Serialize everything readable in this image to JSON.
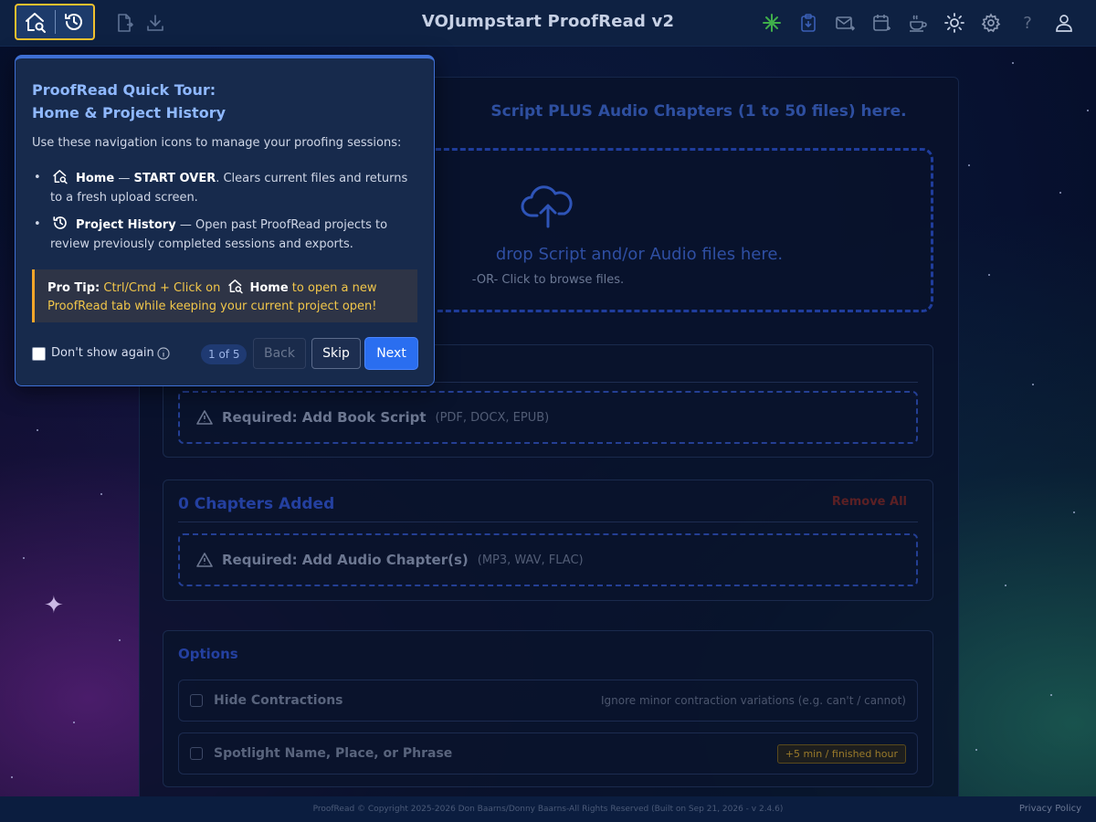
{
  "header": {
    "title": "VOJumpstart ProofRead v2"
  },
  "upload": {
    "heading": "Script PLUS Audio Chapters (1 to 50 files) here.",
    "drop_main": "drop Script and/or Audio files here.",
    "drop_sub": "-OR- Click to browse files."
  },
  "script_section": {
    "required_label": "Required: Add Book Script",
    "formats": "(PDF, DOCX, EPUB)"
  },
  "chapters_section": {
    "title": "0 Chapters Added",
    "remove_all": "Remove All",
    "required_label": "Required: Add Audio Chapter(s)",
    "formats": "(MP3, WAV, FLAC)"
  },
  "options": {
    "title": "Options",
    "items": [
      {
        "label": "Hide Contractions",
        "hint": "Ignore minor contraction variations (e.g. can't / cannot)"
      },
      {
        "label": "Spotlight Name, Place, or Phrase",
        "badge": "+5 min / finished hour"
      }
    ]
  },
  "footer": {
    "copyright": "ProofRead © Copyright 2025-2026 Don Baarns/Donny Baarns-All Rights Reserved (Built on Sep 21, 2026 - v 2.4.6)",
    "privacy": "Privacy Policy"
  },
  "tour": {
    "title_line1": "ProofRead Quick Tour:",
    "title_line2": "Home & Project History",
    "intro": "Use these navigation icons to manage your proofing sessions:",
    "items": [
      {
        "name": "Home",
        "sep": " — ",
        "emphasis": "START OVER",
        "text": ". Clears current files and returns to a fresh upload screen."
      },
      {
        "name": "Project History",
        "sep": " — ",
        "text": "Open past ProofRead projects to review previously completed sessions and exports."
      }
    ],
    "tip": {
      "label": "Pro Tip:",
      "text1": " Ctrl/Cmd + Click on ",
      "home": "Home",
      "text2": " to open a new ProofRead tab while keeping your current project open!"
    },
    "dont_show_again": "Don't show again",
    "step": "1 of 5",
    "back": "Back",
    "skip": "Skip",
    "next": "Next"
  },
  "colors": {
    "accent": "#2a6ef0",
    "highlight_border": "#f2c12e",
    "tip_text": "#f1c64a"
  }
}
